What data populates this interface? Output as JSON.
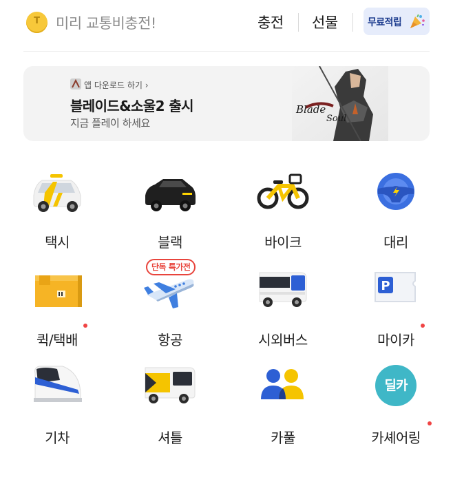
{
  "header": {
    "coin_glyph": "T",
    "charge_hint": "미리 교통비충전!",
    "charge_label": "충전",
    "gift_label": "선물",
    "free_points_label": "무료적립"
  },
  "banner": {
    "small_text": "앱 다운로드 하기",
    "title": "블레이드&소울2 출시",
    "subtitle": "지금 플레이 하세요"
  },
  "services": [
    {
      "label": "택시",
      "icon": "taxi-icon",
      "has_dot": false
    },
    {
      "label": "블랙",
      "icon": "black-car-icon",
      "has_dot": false
    },
    {
      "label": "바이크",
      "icon": "bike-icon",
      "has_dot": false
    },
    {
      "label": "대리",
      "icon": "steering-wheel-icon",
      "has_dot": false
    },
    {
      "label": "퀵/택배",
      "icon": "parcel-box-icon",
      "has_dot": true
    },
    {
      "label": "항공",
      "icon": "airplane-icon",
      "has_dot": false,
      "badge": "단독 특가전"
    },
    {
      "label": "시외버스",
      "icon": "bus-icon",
      "has_dot": false
    },
    {
      "label": "마이카",
      "icon": "parking-ticket-icon",
      "has_dot": true
    },
    {
      "label": "기차",
      "icon": "train-icon",
      "has_dot": false
    },
    {
      "label": "셔틀",
      "icon": "shuttle-icon",
      "has_dot": false
    },
    {
      "label": "카풀",
      "icon": "carpool-icon",
      "has_dot": false
    },
    {
      "label": "카셰어링",
      "icon": "car-sharing-icon",
      "has_dot": true,
      "icon_text": "딜카"
    }
  ],
  "colors": {
    "accent_dot": "#f04444",
    "free_button_bg": "#e6ecfb",
    "coin": "#f7c83a"
  }
}
